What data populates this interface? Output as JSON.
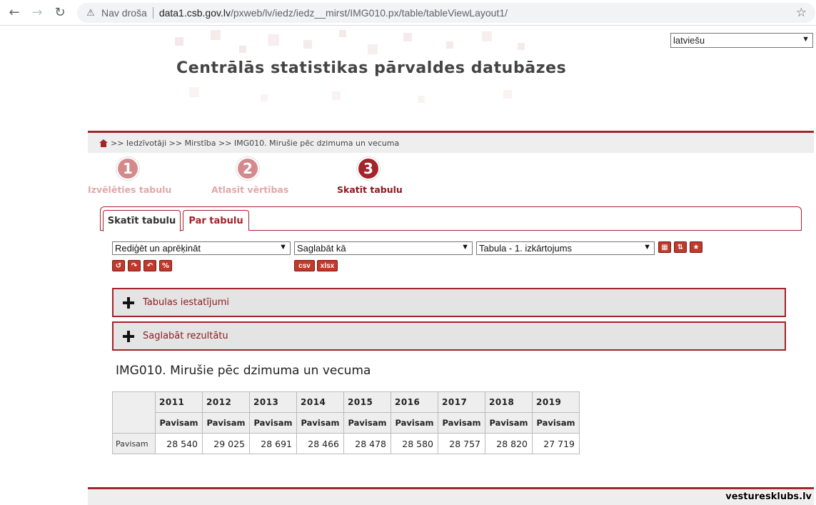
{
  "browser": {
    "security_label": "Nav droša",
    "url_host": "data1.csb.gov.lv",
    "url_path": "/pxweb/lv/iedz/iedz__mirst/IMG010.px/table/tableViewLayout1/"
  },
  "language": {
    "selected": "latviešu"
  },
  "header": {
    "title": "Centrālās statistikas pārvaldes datubāzes"
  },
  "breadcrumb": {
    "path": ">> Iedzīvotāji >> Mirstība >> IMG010. Mirušie pēc dzimuma un vecuma"
  },
  "steps": [
    {
      "number": "1",
      "label": "Izvēlēties tabulu"
    },
    {
      "number": "2",
      "label": "Atlasīt vērtības"
    },
    {
      "number": "3",
      "label": "Skatīt tabulu"
    }
  ],
  "tabs": [
    {
      "label": "Skatīt tabulu"
    },
    {
      "label": "Par tabulu"
    }
  ],
  "toolbar": {
    "edit_select": "Rediģēt un aprēķināt",
    "save_select": "Saglabāt kā",
    "layout_select": "Tabula - 1. izkārtojums",
    "csv_label": "csv",
    "xlsx_label": "xlsx"
  },
  "accordions": {
    "settings": "Tabulas iestatījumi",
    "save_result": "Saglabāt rezultātu"
  },
  "table": {
    "title": "IMG010. Mirušie pēc dzimuma un vecuma",
    "years": [
      "2011",
      "2012",
      "2013",
      "2014",
      "2015",
      "2016",
      "2017",
      "2018",
      "2019"
    ],
    "sub_header": [
      "Pavisam",
      "Pavisam",
      "Pavisam",
      "Pavisam",
      "Pavisam",
      "Pavisam",
      "Pavisam",
      "Pavisam",
      "Pavisam"
    ],
    "row_label": "Pavisam",
    "values": [
      "28 540",
      "29 025",
      "28 691",
      "28 466",
      "28 478",
      "28 580",
      "28 757",
      "28 820",
      "27 719"
    ]
  },
  "watermark": "vesturesklubs.lv"
}
